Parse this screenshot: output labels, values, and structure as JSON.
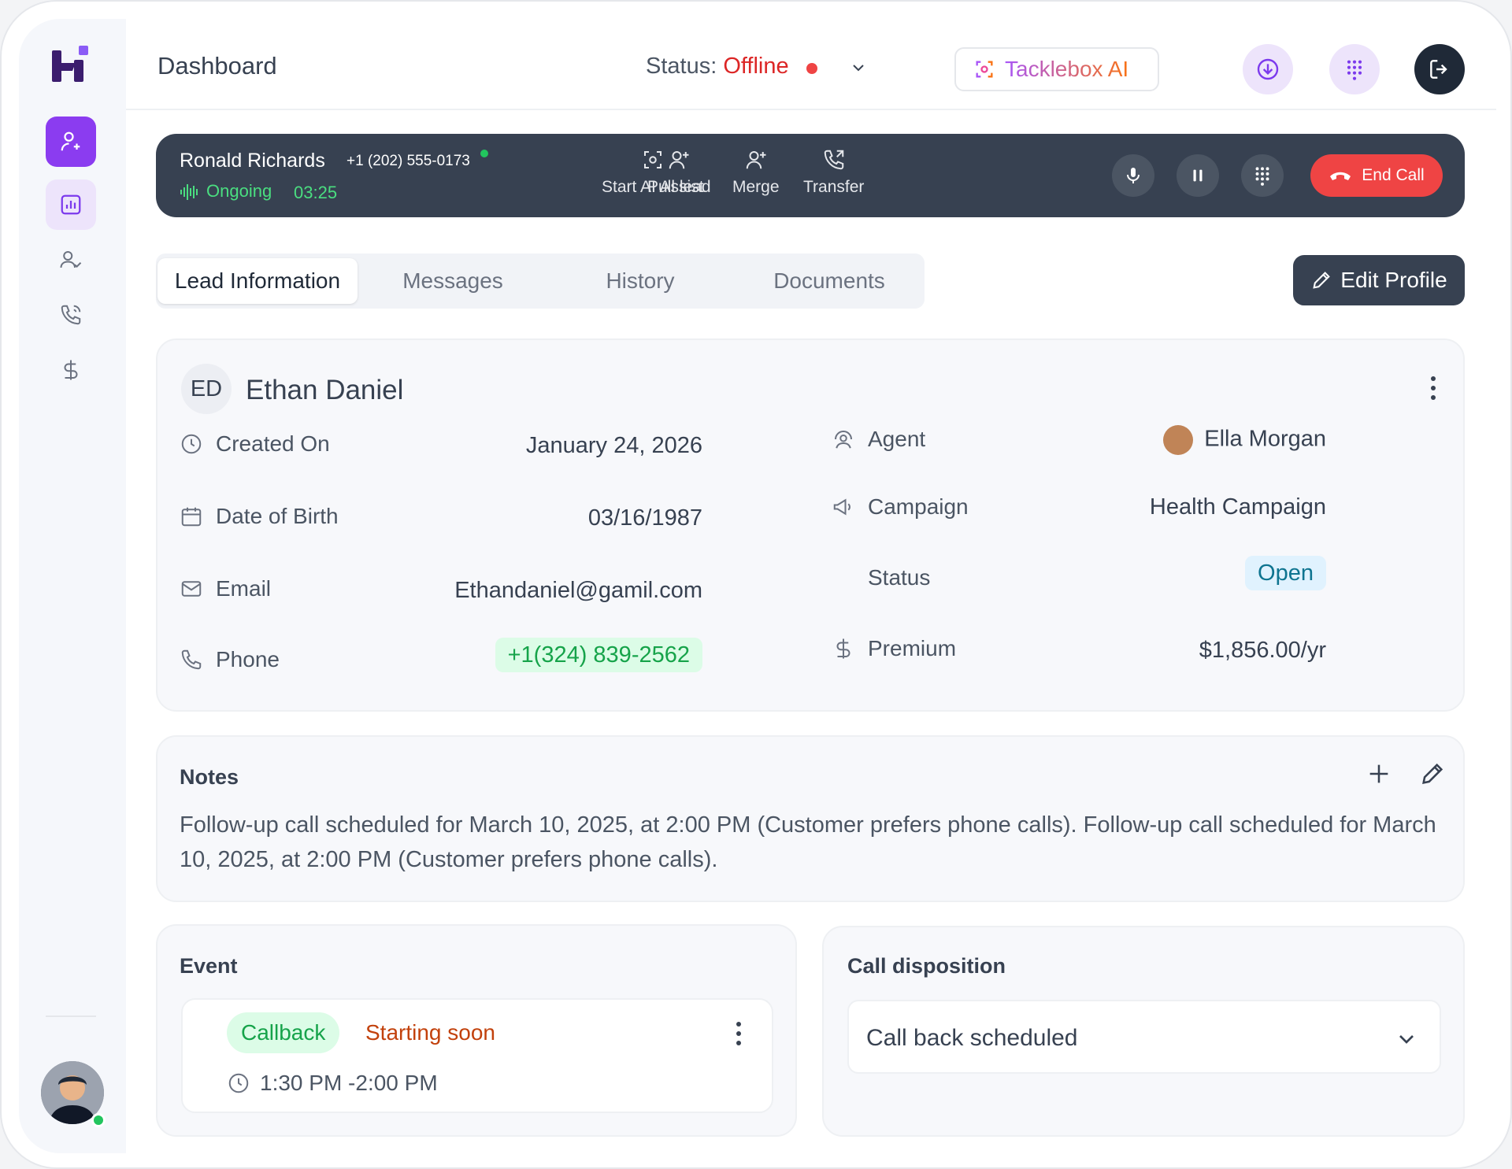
{
  "header": {
    "title": "Dashboard",
    "status_label": "Status:",
    "status_value": "Offline",
    "ai_button": "Tacklebox AI"
  },
  "call": {
    "caller_name": "Ronald Richards",
    "caller_phone": "+1 (202) 555-0173",
    "state": "Ongoing",
    "duration": "03:25",
    "actions": [
      "Start AI Assist",
      "Pull lead",
      "Merge",
      "Transfer"
    ],
    "end_label": "End Call"
  },
  "tabs": [
    "Lead Information",
    "Messages",
    "History",
    "Documents"
  ],
  "edit_profile": "Edit Profile",
  "lead": {
    "initials": "ED",
    "name": "Ethan Daniel",
    "left": [
      {
        "label": "Created On",
        "value": "January 24, 2026"
      },
      {
        "label": "Date of Birth",
        "value": "03/16/1987"
      },
      {
        "label": "Email",
        "value": "Ethandaniel@gamil.com"
      },
      {
        "label": "Phone",
        "value": "+1(324) 839-2562"
      }
    ],
    "right": [
      {
        "label": "Agent",
        "value": "Ella Morgan"
      },
      {
        "label": "Campaign",
        "value": "Health Campaign"
      },
      {
        "label": "Status",
        "value": "Open"
      },
      {
        "label": "Premium",
        "value": "$1,856.00/yr"
      }
    ]
  },
  "notes": {
    "title": "Notes",
    "text": "Follow-up call scheduled for March 10, 2025, at 2:00 PM (Customer prefers phone calls). Follow-up call scheduled for March 10, 2025, at 2:00 PM (Customer prefers phone calls)."
  },
  "event": {
    "title": "Event",
    "type": "Callback",
    "status": "Starting soon",
    "time": "1:30 PM -2:00 PM"
  },
  "disposition": {
    "title": "Call disposition",
    "selected": "Call back scheduled"
  },
  "colors": {
    "accent": "#8b3cf0",
    "danger": "#ef4444",
    "success": "#16a34a",
    "dark": "#374151"
  }
}
